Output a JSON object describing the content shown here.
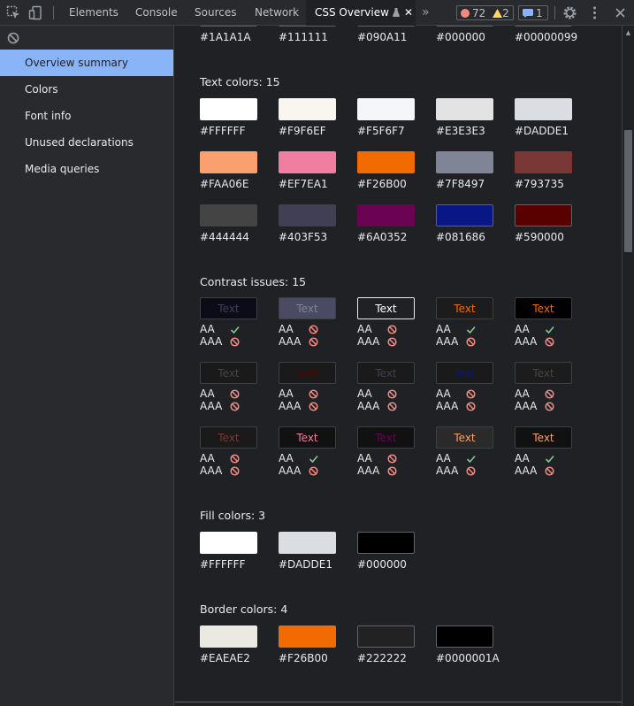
{
  "toolbar": {
    "tabs": [
      "Elements",
      "Console",
      "Sources",
      "Network"
    ],
    "active_tab": "CSS Overview",
    "errors_count": "72",
    "warnings_count": "2",
    "messages_count": "1",
    "colors": {
      "error": "#f28b82",
      "warning": "#fdd663",
      "info": "#8ab4f8"
    }
  },
  "sidebar": {
    "items": [
      "Overview summary",
      "Colors",
      "Font info",
      "Unused declarations",
      "Media queries"
    ],
    "selected_index": 0
  },
  "top_row": [
    "#1A1A1A",
    "#111111",
    "#090A11",
    "#000000",
    "#00000099"
  ],
  "text_colors": {
    "title": "Text colors: 15",
    "rows": [
      [
        "#FFFFFF",
        "#F9F6EF",
        "#F5F6F7",
        "#E3E3E3",
        "#DADDE1"
      ],
      [
        "#FAA06E",
        "#EF7EA1",
        "#F26B00",
        "#7F8497",
        "#793735"
      ],
      [
        "#444444",
        "#403F53",
        "#6A0352",
        "#081686",
        "#590000"
      ]
    ]
  },
  "contrast": {
    "title": "Contrast issues: 15",
    "sample_text": "Text",
    "aa_label": "AA",
    "aaa_label": "AAA",
    "rows": [
      [
        {
          "fg": "#403F53",
          "bg": "#0b0c18",
          "aa": true,
          "aaa": false
        },
        {
          "fg": "#7F8497",
          "bg": "#4a4b63",
          "aa": false,
          "aaa": false
        },
        {
          "fg": "#FFFFFF",
          "bg": "#202124",
          "aa": false,
          "aaa": false,
          "outlined": true
        },
        {
          "fg": "#F26B00",
          "bg": "#1c1c1c",
          "aa": true,
          "aaa": false
        },
        {
          "fg": "#F26B00",
          "bg": "#000000",
          "aa": true,
          "aaa": false
        }
      ],
      [
        {
          "fg": "#444444",
          "bg": "#1a1a1a",
          "aa": false,
          "aaa": false
        },
        {
          "fg": "#590000",
          "bg": "#1a1a1a",
          "aa": false,
          "aaa": false
        },
        {
          "fg": "#403F53",
          "bg": "#1a1a1a",
          "aa": false,
          "aaa": false
        },
        {
          "fg": "#081686",
          "bg": "#1a1a1a",
          "aa": false,
          "aaa": false
        },
        {
          "fg": "#444444",
          "bg": "#1c1c1c",
          "aa": false,
          "aaa": false
        }
      ],
      [
        {
          "fg": "#793735",
          "bg": "#1a1a1a",
          "aa": false,
          "aaa": false
        },
        {
          "fg": "#EF7EA1",
          "bg": "#111111",
          "aa": true,
          "aaa": false
        },
        {
          "fg": "#6A0352",
          "bg": "#111111",
          "aa": false,
          "aaa": false
        },
        {
          "fg": "#FAA06E",
          "bg": "#2a2a2a",
          "aa": true,
          "aaa": false
        },
        {
          "fg": "#FAA06E",
          "bg": "#111111",
          "aa": true,
          "aaa": false
        }
      ]
    ]
  },
  "fill_colors": {
    "title": "Fill colors: 3",
    "items": [
      "#FFFFFF",
      "#DADDE1",
      "#000000"
    ]
  },
  "border_colors": {
    "title": "Border colors: 4",
    "items": [
      "#EAEAE2",
      "#F26B00",
      "#222222",
      "#0000001A"
    ]
  }
}
